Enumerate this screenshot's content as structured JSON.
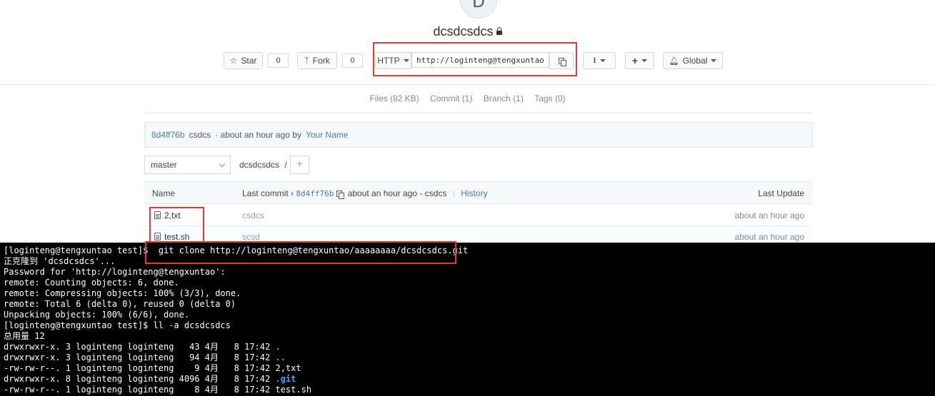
{
  "repo": {
    "avatar_letter": "D",
    "name": "dcsdcsdcs"
  },
  "actions": {
    "star_label": "Star",
    "star_count": "0",
    "fork_label": "Fork",
    "fork_count": "0",
    "protocol": "HTTP",
    "clone_url": "http://loginteng@tengxuntao/aaaaaaaa/dcsdcsdcs.git",
    "visibility_label": "Global"
  },
  "stats": {
    "files": "Files (82 KB)",
    "commits": "Commit (1)",
    "branches": "Branch (1)",
    "tags": "Tags (0)"
  },
  "last_commit": {
    "sha": "8d4ff76b",
    "message": "csdcs",
    "time_text": "· about an hour ago by",
    "author": "Your Name"
  },
  "branch": {
    "selected": "master",
    "path": "dcsdcsdcs",
    "path_sep": "/"
  },
  "table": {
    "col_name": "Name",
    "col_last_commit": "Last commit ›",
    "commit_sha": "8d4ff76b",
    "commit_summary": "about an hour ago - csdcs",
    "history_link": "History",
    "col_last_update": "Last Update",
    "rows": [
      {
        "name": "2,txt",
        "commit": "csdcs",
        "updated": "about an hour ago"
      },
      {
        "name": "test.sh",
        "commit": "scsd",
        "updated": "about an hour ago"
      }
    ]
  },
  "terminal": {
    "lines": [
      "[loginteng@tengxuntao test]$  git clone http://loginteng@tengxuntao/aaaaaaaa/dcsdcsdcs.git",
      "正克隆到 'dcsdcsdcs'...",
      "Password for 'http://loginteng@tengxuntao':",
      "remote: Counting objects: 6, done.",
      "remote: Compressing objects: 100% (3/3), done.",
      "remote: Total 6 (delta 0), reused 0 (delta 0)",
      "Unpacking objects: 100% (6/6), done.",
      "[loginteng@tengxuntao test]$ ll -a dcsdcsdcs",
      "总用量 12"
    ],
    "listing": [
      {
        "meta": "drwxrwxr-x. 3 loginteng loginteng   43 4月   8 17:42 ",
        "name": ".",
        "is_dir": true
      },
      {
        "meta": "drwxrwxr-x. 3 loginteng loginteng   94 4月   8 17:42 ",
        "name": "..",
        "is_dir": true
      },
      {
        "meta": "-rw-rw-r--. 1 loginteng loginteng    9 4月   8 17:42 ",
        "name": "2,txt",
        "is_dir": false
      },
      {
        "meta": "drwxrwxr-x. 8 loginteng loginteng 4096 4月   8 17:42 ",
        "name": ".git",
        "is_dir": true
      },
      {
        "meta": "-rw-rw-r--. 1 loginteng loginteng    8 4月   8 17:42 ",
        "name": "test.sh",
        "is_dir": false
      }
    ]
  },
  "colors": {
    "highlight": "#e53935",
    "link": "#4a7ba7",
    "terminal_bg": "#000000",
    "terminal_dir": "#5c9cff"
  }
}
